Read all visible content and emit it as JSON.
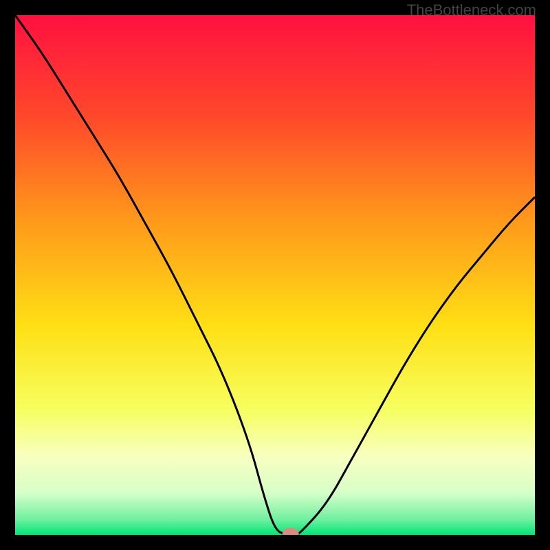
{
  "attribution": "TheBottleneck.com",
  "chart_data": {
    "type": "line",
    "title": "",
    "xlabel": "",
    "ylabel": "",
    "xlim": [
      0,
      100
    ],
    "ylim": [
      0,
      100
    ],
    "x": [
      0,
      5,
      10,
      15,
      20,
      25,
      30,
      35,
      40,
      45,
      48,
      50,
      52,
      54,
      55,
      60,
      65,
      70,
      75,
      80,
      85,
      90,
      95,
      100
    ],
    "values": [
      100,
      93,
      85,
      77,
      69,
      60,
      51,
      41,
      31,
      18,
      7,
      1,
      0,
      0,
      0.5,
      6,
      15,
      24,
      33,
      41,
      48,
      54,
      60,
      65
    ],
    "marker": {
      "x": 53,
      "y": 0.3
    },
    "gradient_stops": [
      {
        "pct": 0,
        "color": "#ff1040"
      },
      {
        "pct": 20,
        "color": "#ff4a2a"
      },
      {
        "pct": 40,
        "color": "#ff9b1a"
      },
      {
        "pct": 60,
        "color": "#ffe015"
      },
      {
        "pct": 76,
        "color": "#f6ff60"
      },
      {
        "pct": 85,
        "color": "#f8ffc0"
      },
      {
        "pct": 92,
        "color": "#d5ffc8"
      },
      {
        "pct": 97,
        "color": "#70f0a0"
      },
      {
        "pct": 100,
        "color": "#00e676"
      }
    ]
  }
}
